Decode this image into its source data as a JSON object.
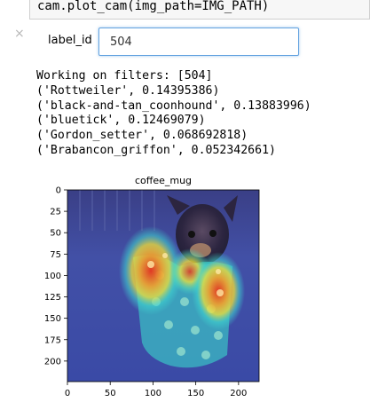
{
  "cell": {
    "code": "cam.plot_cam(img_path=IMG_PATH)"
  },
  "widget": {
    "close_glyph": "×",
    "label": "label_id",
    "value": "504"
  },
  "output": {
    "lines": [
      "Working on filters: [504]",
      "('Rottweiler', 0.14395386)",
      "('black-and-tan_coonhound', 0.13883996)",
      "('bluetick', 0.12469079)",
      "('Gordon_setter', 0.068692818)",
      "('Brabancon_griffon', 0.052342661)"
    ]
  },
  "chart_data": {
    "type": "heatmap",
    "title": "coffee_mug",
    "xlabel": "",
    "ylabel": "",
    "xlim": [
      0,
      224
    ],
    "ylim": [
      224,
      0
    ],
    "xticks": [
      0,
      50,
      100,
      150,
      200
    ],
    "yticks": [
      0,
      25,
      50,
      75,
      100,
      125,
      150,
      175,
      200
    ],
    "grid": false,
    "legend": "none",
    "colormap": "jet overlay on photo",
    "hotspots": [
      {
        "x": 105,
        "y": 95,
        "intensity": 1.0
      },
      {
        "x": 155,
        "y": 95,
        "intensity": 0.7
      },
      {
        "x": 195,
        "y": 115,
        "intensity": 0.9
      }
    ],
    "colors": {
      "cold": "#2f3f9e",
      "warm_red": "#e8331d",
      "warm_yellow": "#f4e236",
      "cyan": "#3fd6d0"
    }
  }
}
